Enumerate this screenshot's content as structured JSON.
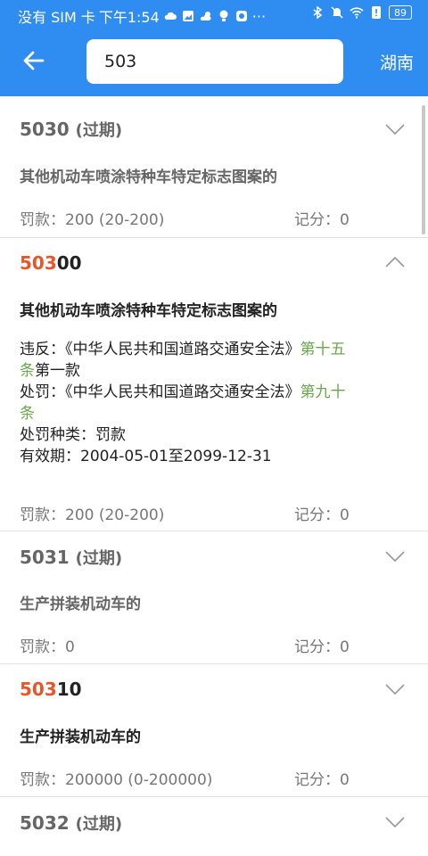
{
  "status_bar": {
    "carrier": "没有 SIM 卡",
    "time": "下午1:54",
    "more": "···",
    "battery": "89"
  },
  "header": {
    "search_value": "503",
    "region": "湖南"
  },
  "items": [
    {
      "code": "5030",
      "code_highlight": "",
      "code_rest": "5030",
      "expired_label": "(过期)",
      "title": "其他机动车喷涂特种车特定标志图案的",
      "fine": "罚款：200 (20-200)",
      "points": "记分：0",
      "expanded": false
    },
    {
      "code_highlight": "503",
      "code_rest": "00",
      "title": "其他机动车喷涂特种车特定标志图案的",
      "violation_prefix": "违反：《中华人民共和国道路交通安全法》",
      "violation_link_line1": "第十五",
      "violation_link_line2": "条",
      "violation_suffix": "第一款",
      "penalty_prefix": "处罚：《中华人民共和国道路交通安全法》",
      "penalty_link_line1": "第九十",
      "penalty_link_line2": "条",
      "penalty_type": "处罚种类：罚款",
      "validity": "有效期：2004-05-01至2099-12-31",
      "fine": "罚款：200 (20-200)",
      "points": "记分：0",
      "expanded": true
    },
    {
      "code": "5031",
      "expired_label": "(过期)",
      "title": "生产拼装机动车的",
      "fine": "罚款：0",
      "points": "记分：0",
      "expanded": false
    },
    {
      "code_highlight": "503",
      "code_rest": "10",
      "title": "生产拼装机动车的",
      "fine": "罚款：200000 (0-200000)",
      "points": "记分：0",
      "expanded": false
    },
    {
      "code": "5032",
      "expired_label": "(过期)",
      "expanded": false
    }
  ]
}
